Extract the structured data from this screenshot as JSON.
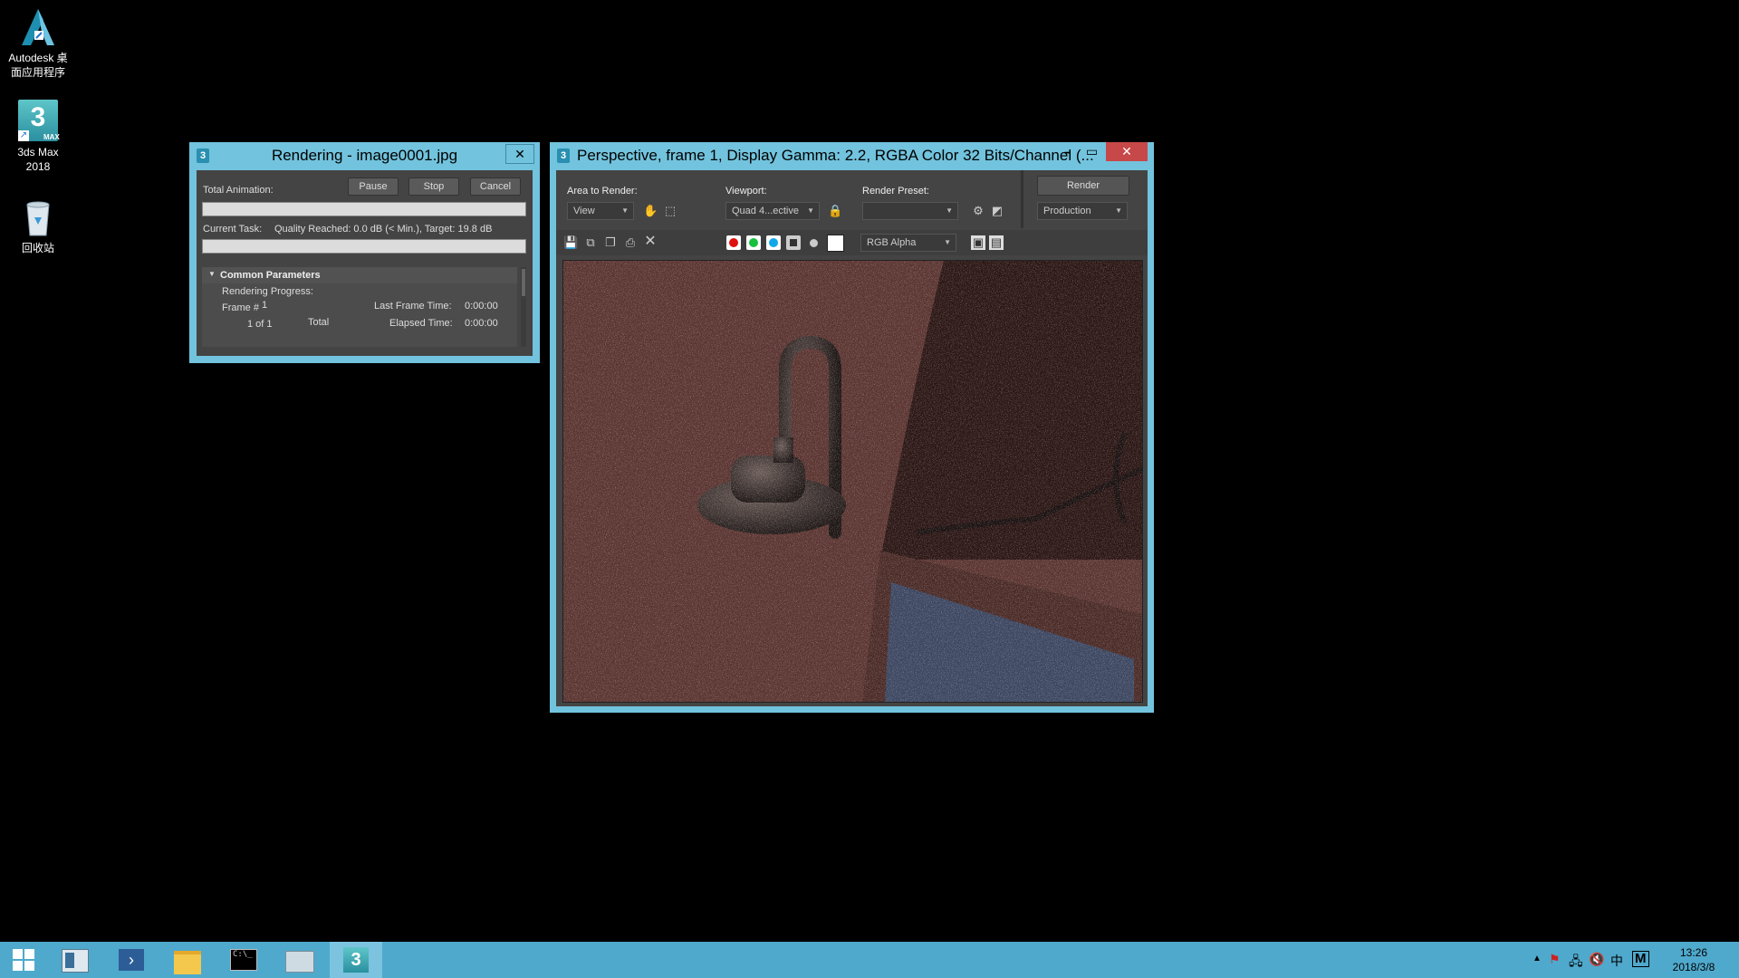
{
  "desktop": {
    "icons": [
      {
        "label_line1": "Autodesk 桌",
        "label_line2": "面应用程序"
      },
      {
        "label_line1": "3ds Max",
        "label_line2": "2018"
      },
      {
        "label_line1": "回收站",
        "label_line2": ""
      }
    ]
  },
  "render_progress": {
    "title": "Rendering - image0001.jpg",
    "close": "✕",
    "total_animation_label": "Total Animation:",
    "pause_label": "Pause",
    "stop_label": "Stop",
    "cancel_label": "Cancel",
    "total_progress": 0,
    "current_task_label": "Current Task:",
    "current_task_value": "Quality Reached: 0.0 dB (< Min.), Target: 19.8 dB",
    "task_progress": 0,
    "rollout_title": "Common Parameters",
    "rendering_progress_label": "Rendering Progress:",
    "frame_label": "Frame #",
    "frame_value": "1",
    "frame_of": "1 of 1",
    "total_label": "Total",
    "last_frame_time_label": "Last Frame Time:",
    "last_frame_time_value": "0:00:00",
    "elapsed_time_label": "Elapsed Time:",
    "elapsed_time_value": "0:00:00"
  },
  "frame_window": {
    "title": "Perspective, frame 1, Display Gamma: 2.2, RGBA Color 32 Bits/Channel (...",
    "minimize": "━",
    "maximize": "▭",
    "close": "✕",
    "area_to_render_label": "Area to Render:",
    "area_to_render_value": "View",
    "viewport_label": "Viewport:",
    "viewport_value": "Quad 4...ective",
    "render_preset_label": "Render Preset:",
    "render_preset_value": "",
    "render_button": "Render",
    "production_value": "Production",
    "channel_value": "RGB Alpha",
    "colors": {
      "red": "#e01010",
      "green": "#18c040",
      "blue": "#10a8e8"
    }
  },
  "taskbar": {
    "time": "13:26",
    "date": "2018/3/8",
    "ime": "M",
    "colors": {
      "bar": "#4fa9cc",
      "active": "#7bc3df"
    }
  }
}
